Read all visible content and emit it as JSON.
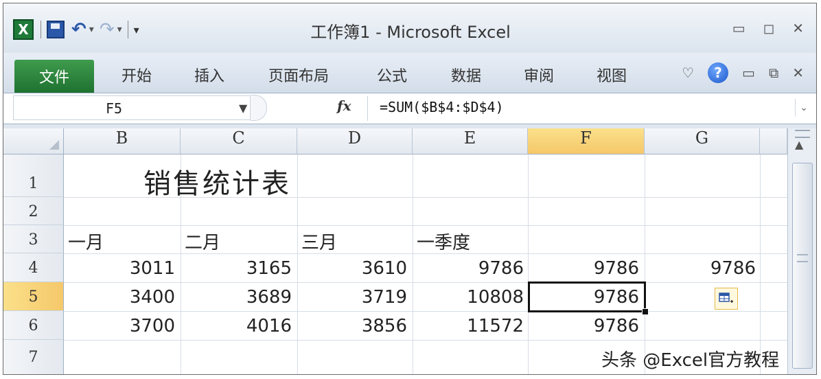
{
  "window": {
    "title": "工作簿1 - Microsoft Excel",
    "app_icon": "X"
  },
  "quick_access": {
    "icons": [
      "excel-icon",
      "save-icon",
      "undo-icon",
      "redo-icon",
      "customize-qat-icon"
    ]
  },
  "ribbon": {
    "file_tab": "文件",
    "tabs": [
      "开始",
      "插入",
      "页面布局",
      "公式",
      "数据",
      "审阅",
      "视图"
    ],
    "help_label": "?"
  },
  "formula_bar": {
    "name_box": "F5",
    "fx_label": "fx",
    "formula": "=SUM($B$4:$D$4)"
  },
  "sheet": {
    "columns": [
      "B",
      "C",
      "D",
      "E",
      "F",
      "G"
    ],
    "selected_column": "F",
    "rows": [
      "1",
      "2",
      "3",
      "4",
      "5",
      "6",
      "7"
    ],
    "selected_row": "5",
    "title": "销售统计表",
    "headers": {
      "b": "一月",
      "c": "二月",
      "d": "三月",
      "e": "一季度"
    },
    "r4": {
      "b": "3011",
      "c": "3165",
      "d": "3610",
      "e": "9786",
      "f": "9786",
      "g": "9786"
    },
    "r5": {
      "b": "3400",
      "c": "3689",
      "d": "3719",
      "e": "10808",
      "f": "9786"
    },
    "r6": {
      "b": "3700",
      "c": "4016",
      "d": "3856",
      "e": "11572",
      "f": "9786"
    }
  },
  "watermark": "头条 @Excel官方教程",
  "colors": {
    "file_tab": "#2e8b3e",
    "selected_header": "#f7d47a",
    "grid_line": "#d6dde6"
  }
}
